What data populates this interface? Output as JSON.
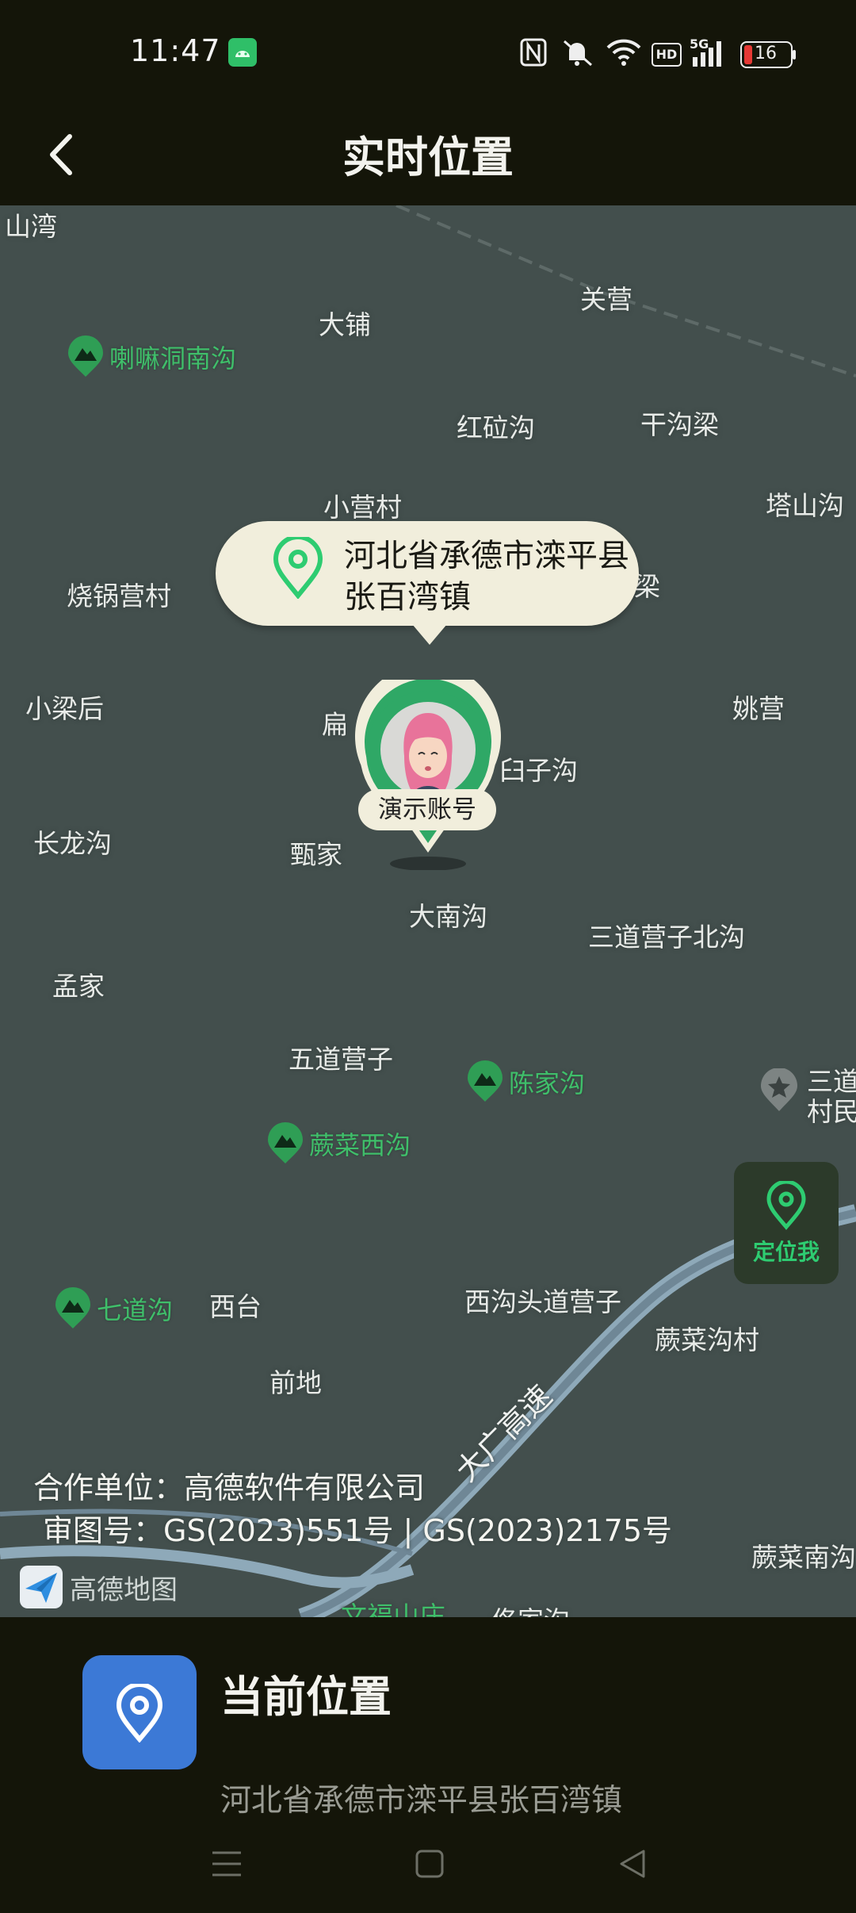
{
  "status_bar": {
    "time": "11:47",
    "battery": "16",
    "network": "5G",
    "hd": "HD"
  },
  "header": {
    "title": "实时位置"
  },
  "map": {
    "places": [
      {
        "name": "山湾"
      },
      {
        "name": "关营"
      },
      {
        "name": "大铺"
      },
      {
        "name": "红砬沟"
      },
      {
        "name": "干沟梁"
      },
      {
        "name": "小营村"
      },
      {
        "name": "塔山沟"
      },
      {
        "name": "烧锅营村"
      },
      {
        "name": "梁"
      },
      {
        "name": "小梁后"
      },
      {
        "name": "姚营"
      },
      {
        "name": "扁",
        "note": "partially hidden"
      },
      {
        "name": "臼子沟"
      },
      {
        "name": "长龙沟"
      },
      {
        "name": "甄家"
      },
      {
        "name": "大南沟"
      },
      {
        "name": "三道营子北沟"
      },
      {
        "name": "孟家"
      },
      {
        "name": "五道营子"
      },
      {
        "name": "西台"
      },
      {
        "name": "西沟头道营子"
      },
      {
        "name": "蕨菜沟村"
      },
      {
        "name": "前地"
      },
      {
        "name": "蕨菜南沟"
      },
      {
        "name": "文福山庄"
      },
      {
        "name": "佟家沟"
      },
      {
        "name": "三道"
      },
      {
        "name": "村民"
      }
    ],
    "pois": [
      {
        "name": "喇嘛洞南沟"
      },
      {
        "name": "陈家沟"
      },
      {
        "name": "蕨菜西沟"
      },
      {
        "name": "七道沟"
      }
    ],
    "road_label": "大广高速",
    "location_bubble": "河北省承德市滦平县张百湾镇",
    "marker_label": "演示账号",
    "locate_button": "定位我",
    "copyright_line1": "合作单位：高德软件有限公司",
    "copyright_line2": "审图号：GS(2023)551号 | GS(2023)2175号",
    "logo_text": "高德地图"
  },
  "current_location": {
    "title": "当前位置",
    "address": "河北省承德市滦平县张百湾镇"
  },
  "colors": {
    "background": "#141509",
    "map": "#434f4d",
    "accent_green": "#2ecc71",
    "tile_blue": "#3c79d6"
  }
}
